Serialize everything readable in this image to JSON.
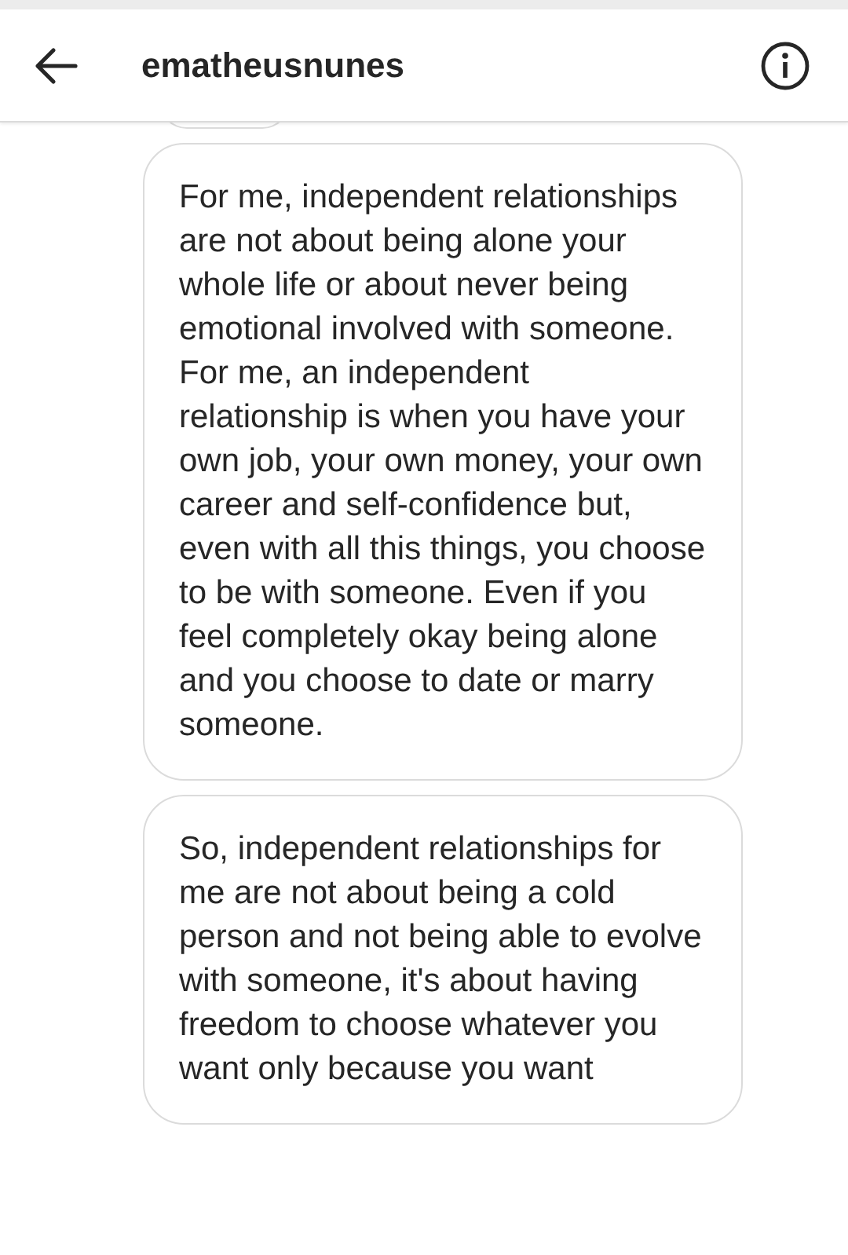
{
  "header": {
    "title": "ematheusnunes"
  },
  "messages": [
    {
      "text": "For me, independent relationships are not about being alone your whole life or about never being emotional involved with someone.\nFor me, an independent relationship is when you have your own job, your own money, your own career and self-confidence but, even with all this things, you choose to be with someone. Even if you feel completely okay being alone and you choose to date or marry someone."
    },
    {
      "text": "So, independent relationships for me are not about being a cold person and not being able to evolve with someone, it's about having freedom to choose whatever you want only because you want"
    }
  ]
}
